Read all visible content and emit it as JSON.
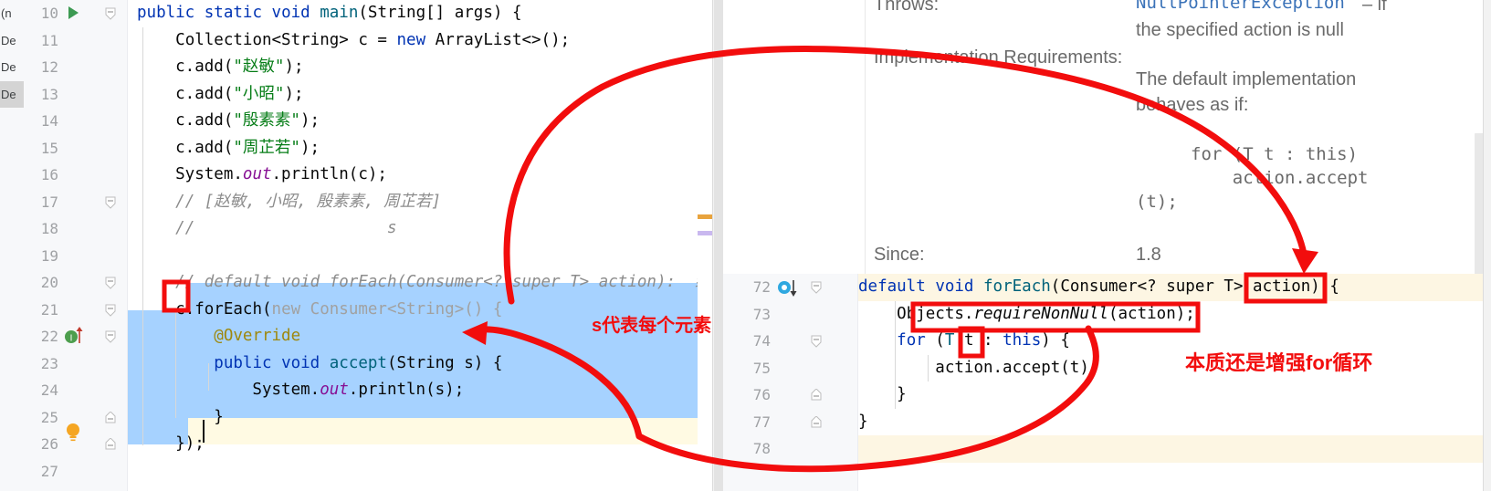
{
  "project_strip": {
    "rows": [
      "(n",
      "De",
      "De",
      "De"
    ]
  },
  "left_editor": {
    "lines": [
      {
        "num": "10",
        "gutter": "run-arrow",
        "fold": "minus",
        "text": "public static void main(String[] args) {"
      },
      {
        "num": "11",
        "gutter": "",
        "fold": "",
        "text": "    Collection<String> c = new ArrayList<>();"
      },
      {
        "num": "12",
        "gutter": "",
        "fold": "",
        "text": "    c.add(\"赵敏\");"
      },
      {
        "num": "13",
        "gutter": "",
        "fold": "",
        "text": "    c.add(\"小昭\");"
      },
      {
        "num": "14",
        "gutter": "",
        "fold": "",
        "text": "    c.add(\"殷素素\");"
      },
      {
        "num": "15",
        "gutter": "",
        "fold": "",
        "text": "    c.add(\"周芷若\");"
      },
      {
        "num": "16",
        "gutter": "",
        "fold": "",
        "text": "    System.out.println(c);"
      },
      {
        "num": "17",
        "gutter": "",
        "fold": "minus",
        "text": "    // [赵敏, 小昭, 殷素素, 周芷若]"
      },
      {
        "num": "18",
        "gutter": "",
        "fold": "",
        "text": "    //                     s"
      },
      {
        "num": "19",
        "gutter": "",
        "fold": "",
        "text": ""
      },
      {
        "num": "20",
        "gutter": "",
        "fold": "minus",
        "text": "    // default void forEach(Consumer<? super T> action):  结"
      },
      {
        "num": "21",
        "gutter": "",
        "fold": "minus",
        "text": "    c.forEach(new Consumer<String>() {"
      },
      {
        "num": "22",
        "gutter": "",
        "fold": "",
        "text": "        @Override"
      },
      {
        "num": "23",
        "gutter": "impl-marker",
        "fold": "minus",
        "text": "        public void accept(String s) {"
      },
      {
        "num": "24",
        "gutter": "",
        "fold": "",
        "text": "            System.out.println(s);"
      },
      {
        "num": "25",
        "gutter": "",
        "fold": "minus",
        "text": "        }"
      },
      {
        "num": "26",
        "gutter": "bulb-icon",
        "fold": "minus",
        "text": "    });"
      },
      {
        "num": "27",
        "gutter": "",
        "fold": "",
        "text": ""
      }
    ],
    "code_tokens": {
      "l10": [
        "public ",
        "static ",
        "void ",
        "main",
        "(String[] args) {"
      ],
      "l11_type": "Collection<String>",
      "l11_new": "new",
      "l11_rest": "ArrayList<>();",
      "strings": [
        "\"赵敏\"",
        "\"小昭\"",
        "\"殷素素\"",
        "\"周芷若\""
      ],
      "comment_17": "// [赵敏, 小昭, 殷素素, 周芷若]",
      "comment_18_slashes": "//",
      "comment_18_s": "s",
      "comment_20": "// default void forEach(Consumer<? super T> action):  结",
      "l21_var": "c",
      "l21_call": ".forEach(",
      "l21_new": "new Consumer<String>() {",
      "l22_annotation": "@Override",
      "l23": "public void accept(String s) {",
      "l24": "System.out.println(s);",
      "l25": "}",
      "l26": "});"
    }
  },
  "doc_popup": {
    "entries": [
      {
        "label": "Throws:",
        "value": "NullPointerException",
        "value_tail": " – if",
        "line2": "the specified action is null"
      },
      {
        "label": "Implementation Requirements:",
        "value": "The default implementation",
        "line2": "behaves as if:"
      },
      {
        "label": "Since:",
        "value": "1.8"
      }
    ],
    "code_block": [
      "for (T t : this)",
      "    action.accept",
      "(t);"
    ]
  },
  "right_editor": {
    "lines": [
      {
        "num": "72",
        "gutter": "override-marker",
        "fold": "minus",
        "text": "default void forEach(Consumer<? super T> action) {"
      },
      {
        "num": "73",
        "gutter": "",
        "fold": "",
        "text": "    Objects.requireNonNull(action);"
      },
      {
        "num": "74",
        "gutter": "",
        "fold": "minus",
        "text": "    for (T t : this) {"
      },
      {
        "num": "75",
        "gutter": "",
        "fold": "",
        "text": "        action.accept(t);"
      },
      {
        "num": "76",
        "gutter": "",
        "fold": "minus",
        "text": "    }"
      },
      {
        "num": "77",
        "gutter": "",
        "fold": "minus",
        "text": "}"
      },
      {
        "num": "78",
        "gutter": "",
        "fold": "",
        "text": ""
      }
    ],
    "tokens": {
      "l72_kw": "default",
      "l72_kw2": "void",
      "l72_name": "forEach",
      "l72_params": "(Consumer<? super T> ",
      "l72_action": "action",
      "l72_tail": ") {",
      "l73_cls": "Objects",
      "l73_dot": ".",
      "l73_m": "requireNonNull",
      "l73_arg": "(action);",
      "l74_for": "for",
      "l74_paren": " (",
      "l74_T": "T",
      "l74_t": "t",
      "l74_mid": " : ",
      "l74_this": "this",
      "l74_tail": ") {",
      "l75": "action.accept(t);",
      "l76": "}",
      "l77": "}"
    }
  },
  "annotations": {
    "note_left": "s代表每个元素",
    "note_right": "本质还是增强for循环",
    "color": "#f20d0d"
  },
  "colors": {
    "selection": "#a6d2ff",
    "current_line": "#fffae3",
    "gutter_bg": "#f7f8fa",
    "keyword": "#0033b3",
    "string": "#067d17",
    "comment": "#8c8c8c",
    "annotation": "#9e880d",
    "field_italic": "#871094",
    "doc_text": "#6a6a6a",
    "doc_link": "#3a72b8"
  }
}
